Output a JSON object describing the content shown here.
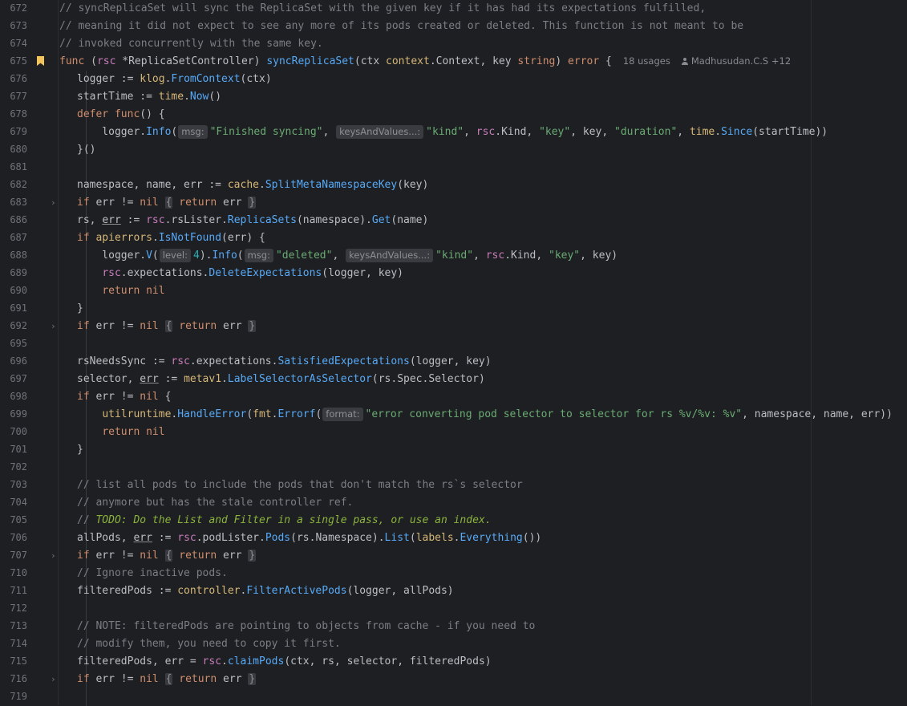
{
  "editor": {
    "line_numbers": [
      "672",
      "673",
      "674",
      "675",
      "676",
      "677",
      "678",
      "679",
      "680",
      "681",
      "682",
      "683",
      "686",
      "687",
      "688",
      "689",
      "690",
      "691",
      "692",
      "695",
      "696",
      "697",
      "698",
      "699",
      "700",
      "701",
      "702",
      "703",
      "704",
      "705",
      "706",
      "707",
      "710",
      "711",
      "712",
      "713",
      "714",
      "715",
      "716",
      "719"
    ],
    "doc_comment": [
      "// syncReplicaSet will sync the ReplicaSet with the given key if it has had its expectations fulfilled,",
      "// meaning it did not expect to see any more of its pods created or deleted. This function is not meant to be",
      "// invoked concurrently with the same key."
    ],
    "usages": "18 usages",
    "author": "Madhusudan.C.S +12",
    "hints": {
      "msg": "msg:",
      "keys_and_values": "keysAndValues...:",
      "level": "level:",
      "format": "format:"
    },
    "strings": {
      "finished_syncing": "\"Finished syncing\"",
      "kind": "\"kind\"",
      "key": "\"key\"",
      "duration": "\"duration\"",
      "deleted": "\"deleted\"",
      "error_fmt": "\"error converting pod selector to selector for rs %v/%v: %v\""
    },
    "comments": {
      "list_pods_1": "// list all pods to include the pods that don't match the rs`s selector",
      "list_pods_2": "// anymore but has the stale controller ref.",
      "todo_prefix": "// ",
      "todo": "TODO: Do the List and Filter in a single pass, or use an index.",
      "ignore_inactive": "// Ignore inactive pods.",
      "note_1": "// NOTE: filteredPods are pointing to objects from cache - if you need to",
      "note_2": "// modify them, you need to copy it first."
    },
    "colors": {
      "background": "#1e1f22",
      "keyword": "#cf8e6d",
      "string": "#6aab73",
      "function": "#56a8f5",
      "comment": "#7a7e85",
      "bookmark": "#f2c55c"
    }
  }
}
